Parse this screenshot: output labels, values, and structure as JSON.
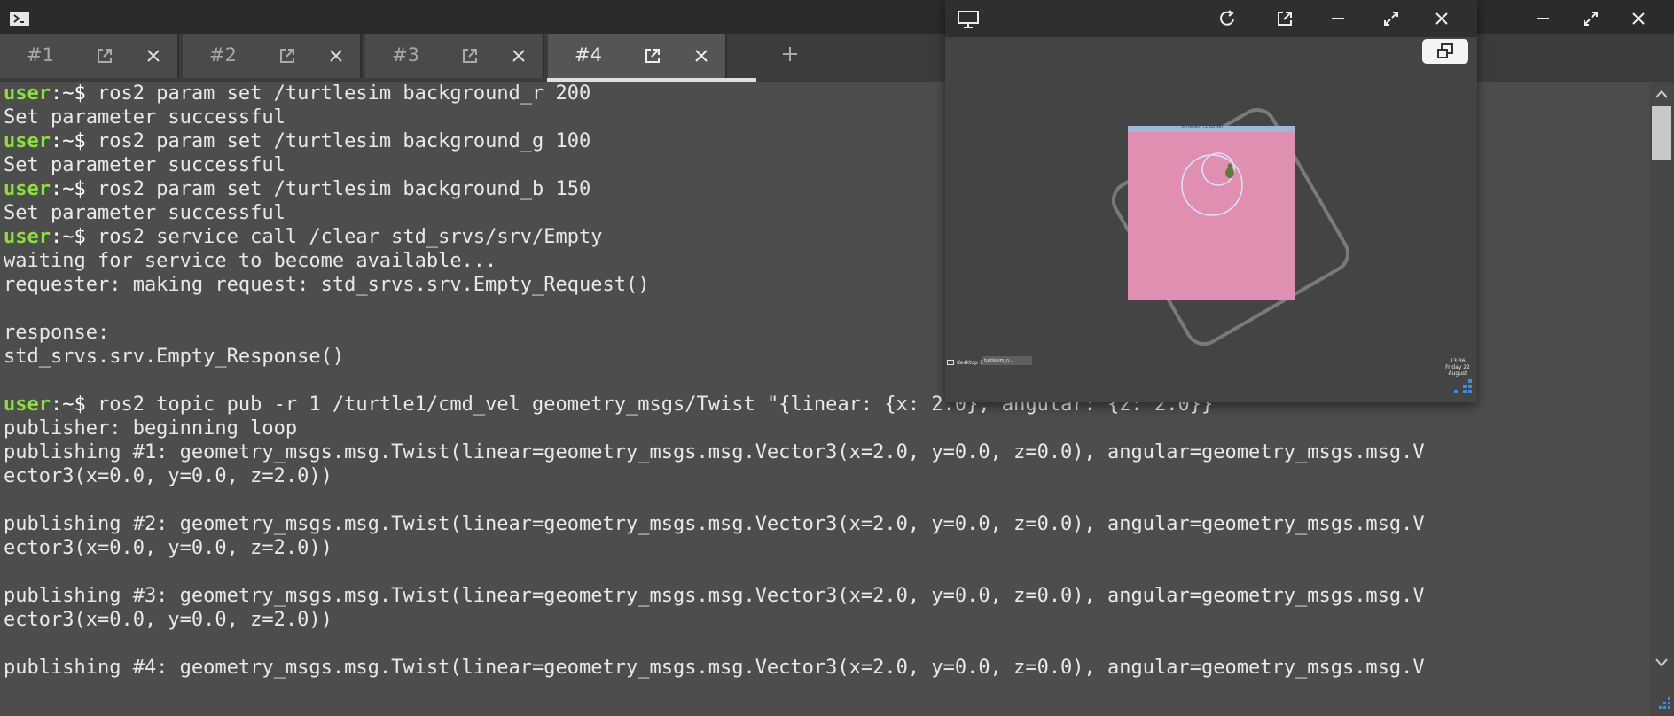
{
  "window": {
    "app_icon": "powershell-icon",
    "controls": [
      "minimize-icon",
      "maximize-icon",
      "close-icon"
    ]
  },
  "tabs": [
    {
      "label": "#1",
      "active": false
    },
    {
      "label": "#2",
      "active": false
    },
    {
      "label": "#3",
      "active": false
    },
    {
      "label": "#4",
      "active": true
    }
  ],
  "add_tab_label": "+",
  "terminal": {
    "prompt_user": "user",
    "prompt_path": ":~",
    "prompt_dollar": "$",
    "lines": [
      {
        "kind": "cmd",
        "text": " ros2 param set /turtlesim background_r 200"
      },
      {
        "kind": "out",
        "text": "Set parameter successful"
      },
      {
        "kind": "cmd",
        "text": " ros2 param set /turtlesim background_g 100"
      },
      {
        "kind": "out",
        "text": "Set parameter successful"
      },
      {
        "kind": "cmd",
        "text": " ros2 param set /turtlesim background_b 150"
      },
      {
        "kind": "out",
        "text": "Set parameter successful"
      },
      {
        "kind": "cmd",
        "text": " ros2 service call /clear std_srvs/srv/Empty"
      },
      {
        "kind": "out",
        "text": "waiting for service to become available..."
      },
      {
        "kind": "out",
        "text": "requester: making request: std_srvs.srv.Empty_Request()"
      },
      {
        "kind": "out",
        "text": ""
      },
      {
        "kind": "out",
        "text": "response:"
      },
      {
        "kind": "out",
        "text": "std_srvs.srv.Empty_Response()"
      },
      {
        "kind": "out",
        "text": ""
      },
      {
        "kind": "cmd",
        "text": " ros2 topic pub -r 1 /turtle1/cmd_vel geometry_msgs/Twist \"{linear: {x: 2.0}, angular: {z: 2.0}}\""
      },
      {
        "kind": "out",
        "text": "publisher: beginning loop"
      },
      {
        "kind": "out",
        "text": "publishing #1: geometry_msgs.msg.Twist(linear=geometry_msgs.msg.Vector3(x=2.0, y=0.0, z=0.0), angular=geometry_msgs.msg.V"
      },
      {
        "kind": "out",
        "text": "ector3(x=0.0, y=0.0, z=2.0))"
      },
      {
        "kind": "out",
        "text": ""
      },
      {
        "kind": "out",
        "text": "publishing #2: geometry_msgs.msg.Twist(linear=geometry_msgs.msg.Vector3(x=2.0, y=0.0, z=0.0), angular=geometry_msgs.msg.V"
      },
      {
        "kind": "out",
        "text": "ector3(x=0.0, y=0.0, z=2.0))"
      },
      {
        "kind": "out",
        "text": ""
      },
      {
        "kind": "out",
        "text": "publishing #3: geometry_msgs.msg.Twist(linear=geometry_msgs.msg.Vector3(x=2.0, y=0.0, z=0.0), angular=geometry_msgs.msg.V"
      },
      {
        "kind": "out",
        "text": "ector3(x=0.0, y=0.0, z=2.0))"
      },
      {
        "kind": "out",
        "text": ""
      },
      {
        "kind": "out",
        "text": "publishing #4: geometry_msgs.msg.Twist(linear=geometry_msgs.msg.Vector3(x=2.0, y=0.0, z=0.0), angular=geometry_msgs.msg.V"
      }
    ]
  },
  "viewer": {
    "icon": "monitor-icon",
    "controls": [
      "refresh-icon",
      "popout-icon",
      "minimize-icon",
      "maximize-icon",
      "close-icon"
    ],
    "sim_title": "TurtleSim (1 turtle)",
    "taskbar_desktop": "desktop 1",
    "taskbar_app": "turtlesim_n...",
    "clock_time": "13:36",
    "clock_date": "Friday 22 August",
    "sim_background": "#e18fb0"
  },
  "colors": {
    "terminal_bg": "#4d4d4d",
    "prompt_user": "#8ae234",
    "text": "#e8e8e8"
  }
}
